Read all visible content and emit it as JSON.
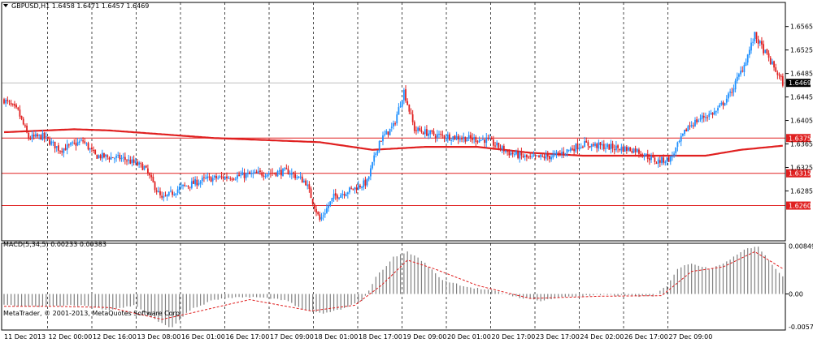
{
  "chart_data": {
    "type": "candlestick",
    "symbol_header": "GBPUSD,H1  1.6458 1.6471 1.6457 1.6469",
    "current_price": "1.6469",
    "price_ticks": [
      "1.6565",
      "1.6525",
      "1.6485",
      "1.6445",
      "1.6405",
      "1.6365",
      "1.6325",
      "1.6285"
    ],
    "price_range": [
      1.62,
      1.6606
    ],
    "horizontal_levels": [
      {
        "price": 1.6375,
        "label": "1.6375"
      },
      {
        "price": 1.6315,
        "label": "1.6315"
      },
      {
        "price": 1.626,
        "label": "1.6260"
      }
    ],
    "time_labels": [
      "11 Dec 2013",
      "12 Dec 00:00",
      "12 Dec 16:00",
      "13 Dec 08:00",
      "16 Dec 01:00",
      "16 Dec 17:00",
      "17 Dec 09:00",
      "18 Dec 01:00",
      "18 Dec 17:00",
      "19 Dec 09:00",
      "20 Dec 01:00",
      "20 Dec 17:00",
      "23 Dec 17:00",
      "24 Dec 02:00",
      "26 Dec 17:00",
      "27 Dec 09:00"
    ],
    "price_series": [
      {
        "label": "close",
        "waypoints": [
          [
            0,
            1.644
          ],
          [
            8,
            1.642
          ],
          [
            14,
            1.6375
          ],
          [
            22,
            1.6378
          ],
          [
            32,
            1.6355
          ],
          [
            45,
            1.637
          ],
          [
            52,
            1.6345
          ],
          [
            68,
            1.634
          ],
          [
            80,
            1.6325
          ],
          [
            90,
            1.627
          ],
          [
            100,
            1.629
          ],
          [
            115,
            1.6305
          ],
          [
            132,
            1.631
          ],
          [
            148,
            1.6315
          ],
          [
            162,
            1.6318
          ],
          [
            172,
            1.63
          ],
          [
            180,
            1.6235
          ],
          [
            188,
            1.6275
          ],
          [
            200,
            1.629
          ],
          [
            207,
            1.63
          ],
          [
            214,
            1.637
          ],
          [
            222,
            1.6395
          ],
          [
            228,
            1.6455
          ],
          [
            234,
            1.639
          ],
          [
            246,
            1.638
          ],
          [
            262,
            1.6375
          ],
          [
            275,
            1.6372
          ],
          [
            288,
            1.635
          ],
          [
            300,
            1.634
          ],
          [
            314,
            1.6345
          ],
          [
            330,
            1.6365
          ],
          [
            344,
            1.636
          ],
          [
            360,
            1.6355
          ],
          [
            372,
            1.6335
          ],
          [
            380,
            1.634
          ],
          [
            390,
            1.6395
          ],
          [
            398,
            1.641
          ],
          [
            406,
            1.642
          ],
          [
            414,
            1.645
          ],
          [
            422,
            1.65
          ],
          [
            428,
            1.655
          ],
          [
            432,
            1.653
          ],
          [
            438,
            1.65
          ],
          [
            444,
            1.6469
          ]
        ]
      }
    ],
    "ma_waypoints": [
      [
        0,
        1.6385
      ],
      [
        40,
        1.639
      ],
      [
        60,
        1.6388
      ],
      [
        120,
        1.6375
      ],
      [
        180,
        1.6368
      ],
      [
        210,
        1.6355
      ],
      [
        240,
        1.636
      ],
      [
        270,
        1.636
      ],
      [
        300,
        1.635
      ],
      [
        330,
        1.6345
      ],
      [
        370,
        1.6345
      ],
      [
        400,
        1.6345
      ],
      [
        420,
        1.6355
      ],
      [
        444,
        1.6362
      ]
    ],
    "macd": {
      "title": "MACD(5,34,5) 0.00233 0.00383",
      "ticks": [
        "0.00849",
        "0.00",
        "-0.00579"
      ],
      "range": [
        -0.0064,
        0.009
      ],
      "hist_waypoints": [
        [
          0,
          -0.002
        ],
        [
          10,
          -0.0021
        ],
        [
          25,
          -0.0022
        ],
        [
          45,
          -0.002
        ],
        [
          60,
          -0.0028
        ],
        [
          75,
          -0.002
        ],
        [
          88,
          -0.005
        ],
        [
          96,
          -0.006
        ],
        [
          105,
          -0.003
        ],
        [
          120,
          -0.001
        ],
        [
          140,
          -0.0005
        ],
        [
          160,
          -0.001
        ],
        [
          172,
          -0.003
        ],
        [
          182,
          -0.0035
        ],
        [
          195,
          -0.0025
        ],
        [
          205,
          -0.001
        ],
        [
          212,
          0.003
        ],
        [
          222,
          0.0065
        ],
        [
          230,
          0.0075
        ],
        [
          238,
          0.006
        ],
        [
          250,
          0.0025
        ],
        [
          265,
          0.0012
        ],
        [
          280,
          0.0005
        ],
        [
          292,
          -0.0005
        ],
        [
          305,
          -0.0012
        ],
        [
          320,
          -0.0005
        ],
        [
          340,
          -0.0002
        ],
        [
          356,
          -0.0003
        ],
        [
          370,
          -0.0005
        ],
        [
          378,
          0.0015
        ],
        [
          384,
          0.0045
        ],
        [
          392,
          0.0055
        ],
        [
          402,
          0.0045
        ],
        [
          414,
          0.006
        ],
        [
          422,
          0.008
        ],
        [
          430,
          0.0085
        ],
        [
          436,
          0.006
        ],
        [
          444,
          0.003
        ]
      ],
      "signal_waypoints": [
        [
          0,
          -0.0022
        ],
        [
          30,
          -0.0022
        ],
        [
          60,
          -0.0024
        ],
        [
          90,
          -0.0045
        ],
        [
          105,
          -0.0035
        ],
        [
          140,
          -0.001
        ],
        [
          175,
          -0.003
        ],
        [
          200,
          -0.002
        ],
        [
          215,
          0.0015
        ],
        [
          230,
          0.006
        ],
        [
          245,
          0.0045
        ],
        [
          270,
          0.0015
        ],
        [
          300,
          -0.0008
        ],
        [
          340,
          -0.0004
        ],
        [
          375,
          -0.0003
        ],
        [
          392,
          0.004
        ],
        [
          410,
          0.0048
        ],
        [
          428,
          0.0075
        ],
        [
          444,
          0.0045
        ]
      ]
    },
    "colors": {
      "bull": "#1e90ff",
      "bear": "#e02020",
      "ma": "#e02020",
      "level": "#e02020",
      "grid": "#000000",
      "hist": "#808080",
      "signal": "#e02020"
    },
    "watermark": "MetaTrader, © 2001-2013, MetaQuotes Software Corp."
  }
}
